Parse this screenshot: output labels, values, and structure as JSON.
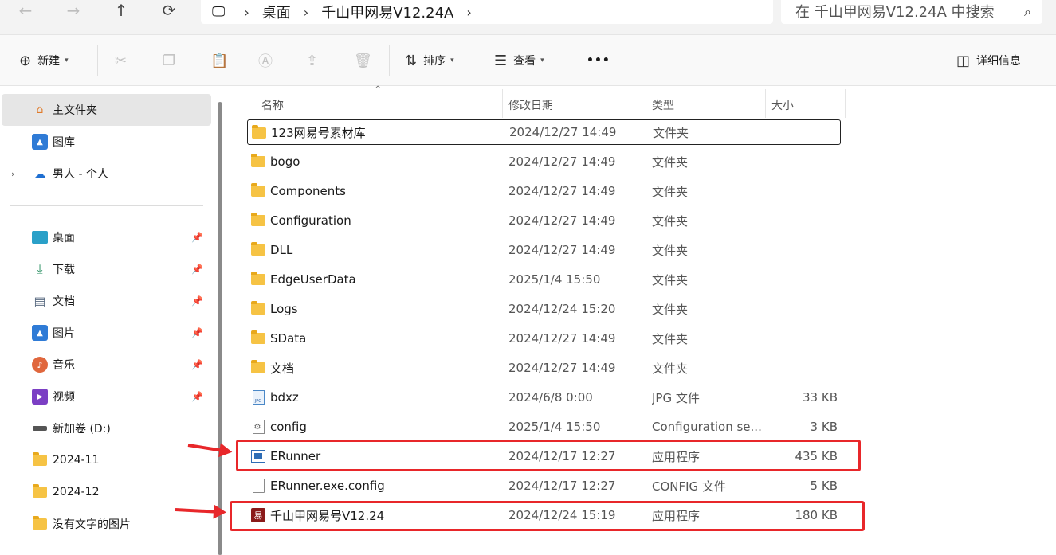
{
  "breadcrumb": {
    "items": [
      "桌面",
      "千山甲网易V12.24A"
    ]
  },
  "search": {
    "placeholder": "在 千山甲网易V12.24A 中搜索"
  },
  "toolbar": {
    "new_label": "新建",
    "sort_label": "排序",
    "view_label": "查看",
    "more_label": "•••",
    "details_label": "详细信息"
  },
  "sidebar": {
    "top_items": [
      {
        "label": "主文件夹",
        "icon": "home-icon"
      },
      {
        "label": "图库",
        "icon": "gallery-icon"
      },
      {
        "label": "男人 - 个人",
        "icon": "onedrive-cloud-icon"
      }
    ],
    "quick_access": [
      {
        "label": "桌面",
        "icon": "desktop-icon"
      },
      {
        "label": "下载",
        "icon": "download-icon"
      },
      {
        "label": "文档",
        "icon": "document-icon"
      },
      {
        "label": "图片",
        "icon": "pictures-icon"
      },
      {
        "label": "音乐",
        "icon": "music-icon"
      },
      {
        "label": "视频",
        "icon": "video-icon"
      },
      {
        "label": "新加卷 (D:)",
        "icon": "drive-icon"
      },
      {
        "label": "2024-11",
        "icon": "folder-icon"
      },
      {
        "label": "2024-12",
        "icon": "folder-icon"
      },
      {
        "label": "没有文字的图片",
        "icon": "folder-icon"
      }
    ]
  },
  "columns": {
    "name": "名称",
    "date": "修改日期",
    "type": "类型",
    "size": "大小"
  },
  "files": [
    {
      "name": "123网易号素材库",
      "date": "2024/12/27 14:49",
      "type": "文件夹",
      "size": "",
      "icon": "folder-icon"
    },
    {
      "name": "bogo",
      "date": "2024/12/27 14:49",
      "type": "文件夹",
      "size": "",
      "icon": "folder-icon"
    },
    {
      "name": "Components",
      "date": "2024/12/27 14:49",
      "type": "文件夹",
      "size": "",
      "icon": "folder-icon"
    },
    {
      "name": "Configuration",
      "date": "2024/12/27 14:49",
      "type": "文件夹",
      "size": "",
      "icon": "folder-icon"
    },
    {
      "name": "DLL",
      "date": "2024/12/27 14:49",
      "type": "文件夹",
      "size": "",
      "icon": "folder-icon"
    },
    {
      "name": "EdgeUserData",
      "date": "2025/1/4 15:50",
      "type": "文件夹",
      "size": "",
      "icon": "folder-icon"
    },
    {
      "name": "Logs",
      "date": "2024/12/24 15:20",
      "type": "文件夹",
      "size": "",
      "icon": "folder-icon"
    },
    {
      "name": "SData",
      "date": "2024/12/27 14:49",
      "type": "文件夹",
      "size": "",
      "icon": "folder-icon"
    },
    {
      "name": "文档",
      "date": "2024/12/27 14:49",
      "type": "文件夹",
      "size": "",
      "icon": "folder-icon"
    },
    {
      "name": "bdxz",
      "date": "2024/6/8 0:00",
      "type": "JPG 文件",
      "size": "33 KB",
      "icon": "jpg-file-icon"
    },
    {
      "name": "config",
      "date": "2025/1/4 15:50",
      "type": "Configuration se...",
      "size": "3 KB",
      "icon": "config-file-icon"
    },
    {
      "name": "ERunner",
      "date": "2024/12/17 12:27",
      "type": "应用程序",
      "size": "435 KB",
      "icon": "exe-app-icon"
    },
    {
      "name": "ERunner.exe.config",
      "date": "2024/12/17 12:27",
      "type": "CONFIG 文件",
      "size": "5 KB",
      "icon": "blank-file-icon"
    },
    {
      "name": "千山甲网易号V12.24",
      "date": "2024/12/24 15:19",
      "type": "应用程序",
      "size": "180 KB",
      "icon": "yi-app-icon"
    }
  ],
  "app_icon_glyph": "易",
  "colors": {
    "highlight": "#e8272a",
    "folder": "#f6c344",
    "selected_bg": "#e6e6e6"
  }
}
